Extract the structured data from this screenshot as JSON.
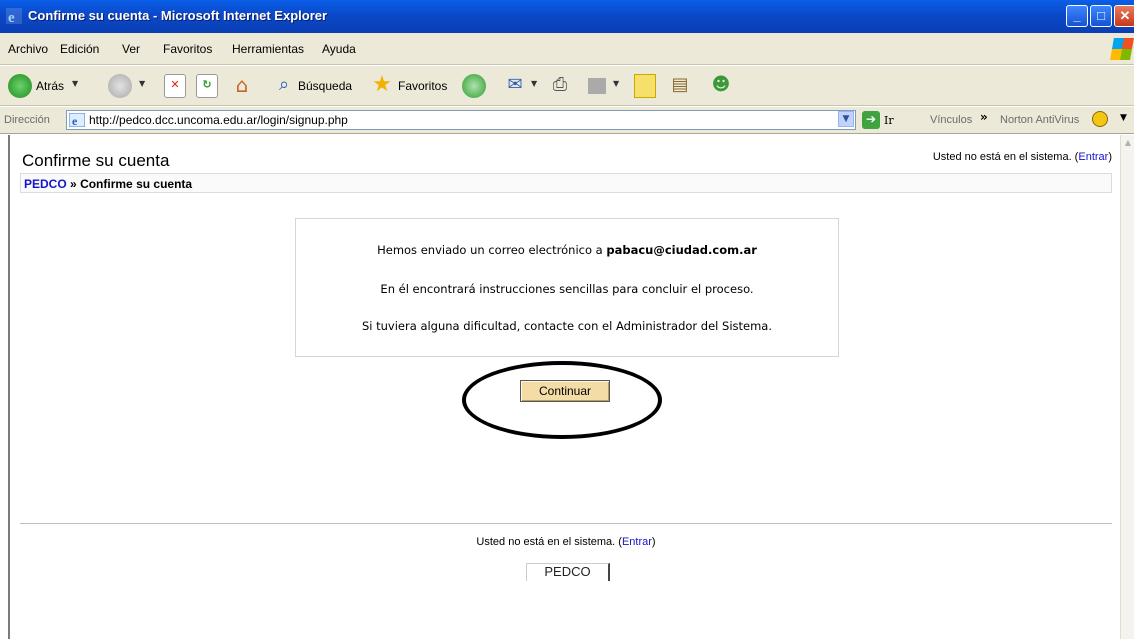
{
  "window": {
    "title": "Confirme su cuenta - Microsoft Internet Explorer",
    "min": "_",
    "max": "□",
    "close": "✕"
  },
  "menu": [
    "Archivo",
    "Edición",
    "Ver",
    "Favoritos",
    "Herramientas",
    "Ayuda"
  ],
  "toolbar": {
    "back_label": "Atrás",
    "search_label": "Búsqueda",
    "favorites_label": "Favoritos"
  },
  "address": {
    "label": "Dirección",
    "url": "http://pedco.dcc.uncoma.edu.ar/login/signup.php",
    "go_label": "Ir",
    "links_label": "Vínculos",
    "norton_label": "Norton AntiVirus"
  },
  "page": {
    "heading": "Confirme su cuenta",
    "login_status": "Usted no está en el sistema.",
    "login_link": "Entrar",
    "breadcrumb_root": "PEDCO",
    "breadcrumb_sep": "»",
    "breadcrumb_current": "Confirme su cuenta",
    "message_line1_prefix": "Hemos enviado un correo electrónico a",
    "message_email": "pabacu@ciudad.com.ar",
    "message_line2": "En él encontrará instrucciones sencillas para concluir el proceso.",
    "message_line3": "Si tuviera alguna dificultad, contacte con el Administrador del Sistema.",
    "continue_button": "Continuar",
    "footer_login_status": "Usted no está en el sistema.",
    "footer_login_link": "Entrar",
    "footer_brand": "PEDCO"
  }
}
